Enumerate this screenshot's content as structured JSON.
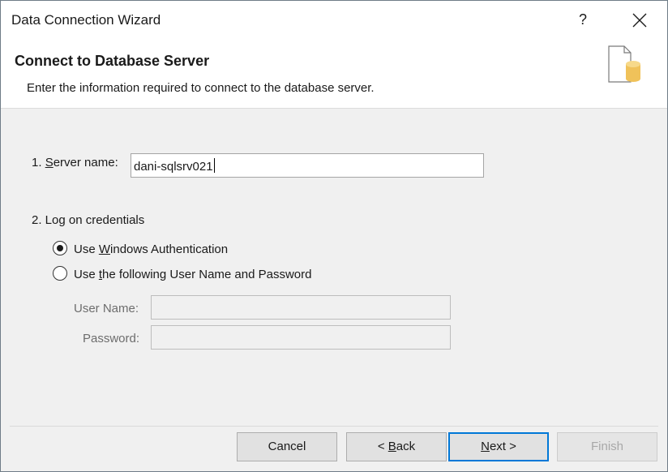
{
  "window": {
    "title": "Data Connection Wizard",
    "help_label": "?"
  },
  "header": {
    "title": "Connect to Database Server",
    "subtitle": "Enter the information required to connect to the database server.",
    "icon": "database-document-icon"
  },
  "server": {
    "label_prefix": "1. ",
    "label_access": "S",
    "label_rest": "erver name:",
    "value": "dani-sqlsrv021"
  },
  "credentials": {
    "heading": "2. Log on credentials",
    "windows_auth": {
      "pre": "Use ",
      "access": "W",
      "post": "indows Authentication",
      "selected": true
    },
    "user_pass": {
      "pre": "Use ",
      "access": "t",
      "post": "he following User Name and Password",
      "selected": false
    },
    "username_label": "User Name:",
    "username_value": "",
    "password_label": "Password:",
    "password_value": ""
  },
  "buttons": {
    "cancel": "Cancel",
    "back_pre": "< ",
    "back_access": "B",
    "back_post": "ack",
    "next_access": "N",
    "next_post": "ext >",
    "finish": "Finish"
  },
  "colors": {
    "accent": "#0078d7",
    "icon_cylinder": "#f0c25a"
  }
}
